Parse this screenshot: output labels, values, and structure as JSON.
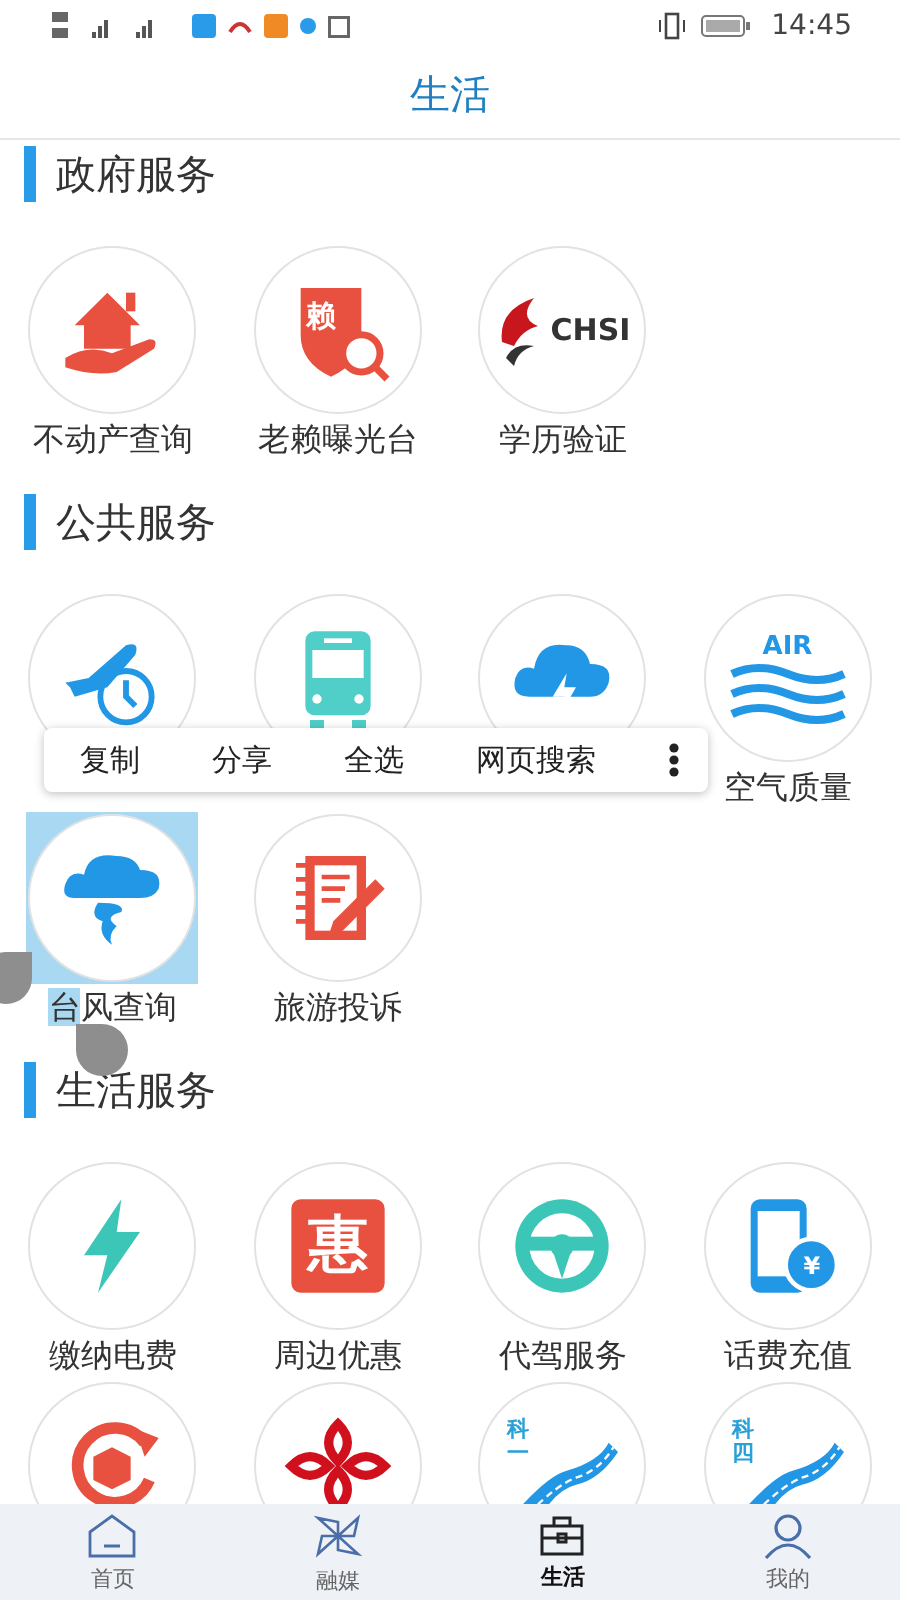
{
  "status_bar": {
    "time": "14:45"
  },
  "header": {
    "title": "生活"
  },
  "sections": [
    {
      "title": "政府服务",
      "items": [
        {
          "kind": "house-hand",
          "label": "不动产查询",
          "selected": false
        },
        {
          "kind": "shield-search",
          "glyph": "赖",
          "label": "老赖曝光台",
          "selected": false
        },
        {
          "kind": "chsi",
          "glyph": "CHSI",
          "label": "学历验证",
          "selected": false
        }
      ]
    },
    {
      "title": "公共服务",
      "items": [
        {
          "kind": "plane-clock",
          "selected": false
        },
        {
          "kind": "bus",
          "selected": false
        },
        {
          "kind": "cloud-bolt",
          "selected": false
        },
        {
          "kind": "air-waves",
          "glyph": "AIR",
          "label": "空气质量",
          "selected": false
        },
        {
          "kind": "typhoon",
          "selected": true,
          "selected_text": "台",
          "label": "风查询"
        },
        {
          "kind": "notebook",
          "label": "旅游投诉",
          "selected": false
        }
      ]
    },
    {
      "title": "生活服务",
      "items": [
        {
          "kind": "bolt",
          "label": "缴纳电费",
          "selected": false
        },
        {
          "kind": "hui",
          "glyph": "惠",
          "label": "周边优惠",
          "selected": false
        },
        {
          "kind": "wheel",
          "label": "代驾服务",
          "selected": false
        },
        {
          "kind": "phone-yen",
          "glyph": "¥",
          "label": "话费充值",
          "selected": false
        },
        {
          "kind": "box-refresh",
          "selected": false
        },
        {
          "kind": "knot",
          "selected": false
        },
        {
          "kind": "road",
          "glyph": "科一",
          "selected": false
        },
        {
          "kind": "road",
          "glyph": "科四",
          "selected": false
        }
      ]
    }
  ],
  "context_menu": {
    "items": [
      "复制",
      "分享",
      "全选",
      "网页搜索"
    ]
  },
  "tab_bar": [
    {
      "kind": "house",
      "label": "首页",
      "selected": false
    },
    {
      "kind": "pinwheel",
      "label": "融媒",
      "selected": false
    },
    {
      "kind": "briefcase",
      "label": "生活",
      "selected": true
    },
    {
      "kind": "person",
      "label": "我的",
      "selected": false
    }
  ]
}
